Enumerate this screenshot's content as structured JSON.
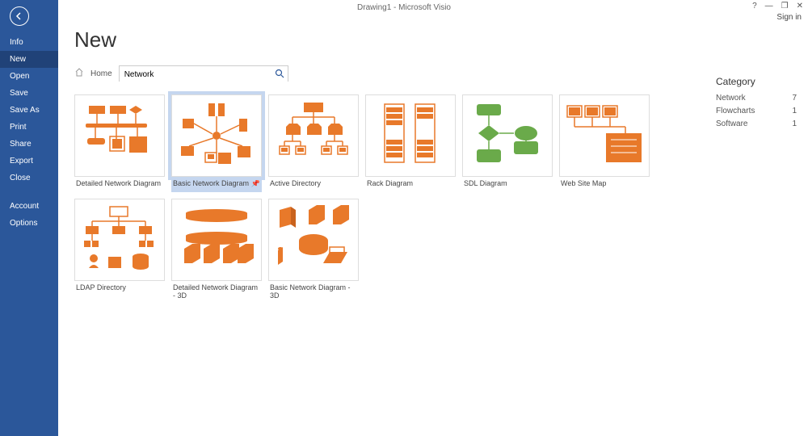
{
  "titlebar": {
    "title": "Drawing1 - Microsoft Visio",
    "help": "?",
    "minimize": "—",
    "restore": "❐",
    "close": "✕",
    "signin": "Sign in"
  },
  "sidebar": {
    "items": [
      "Info",
      "New",
      "Open",
      "Save",
      "Save As",
      "Print",
      "Share",
      "Export",
      "Close"
    ],
    "footer": [
      "Account",
      "Options"
    ],
    "selected": "New"
  },
  "page": {
    "title": "New",
    "home_label": "Home"
  },
  "search": {
    "value": "Network"
  },
  "templates": [
    {
      "name": "Detailed Network Diagram",
      "kind": "network-detailed",
      "selected": false
    },
    {
      "name": "Basic Network Diagram",
      "kind": "network-basic",
      "selected": true,
      "pinned": true
    },
    {
      "name": "Active Directory",
      "kind": "active-directory",
      "selected": false
    },
    {
      "name": "Rack Diagram",
      "kind": "rack",
      "selected": false
    },
    {
      "name": "SDL Diagram",
      "kind": "sdl",
      "selected": false
    },
    {
      "name": "Web Site Map",
      "kind": "sitemap",
      "selected": false
    },
    {
      "name": "LDAP Directory",
      "kind": "ldap",
      "selected": false
    },
    {
      "name": "Detailed Network Diagram - 3D",
      "kind": "network-detailed-3d",
      "selected": false
    },
    {
      "name": "Basic Network Diagram - 3D",
      "kind": "network-basic-3d",
      "selected": false
    }
  ],
  "category": {
    "title": "Category",
    "rows": [
      {
        "label": "Network",
        "count": 7
      },
      {
        "label": "Flowcharts",
        "count": 1
      },
      {
        "label": "Software",
        "count": 1
      }
    ]
  }
}
